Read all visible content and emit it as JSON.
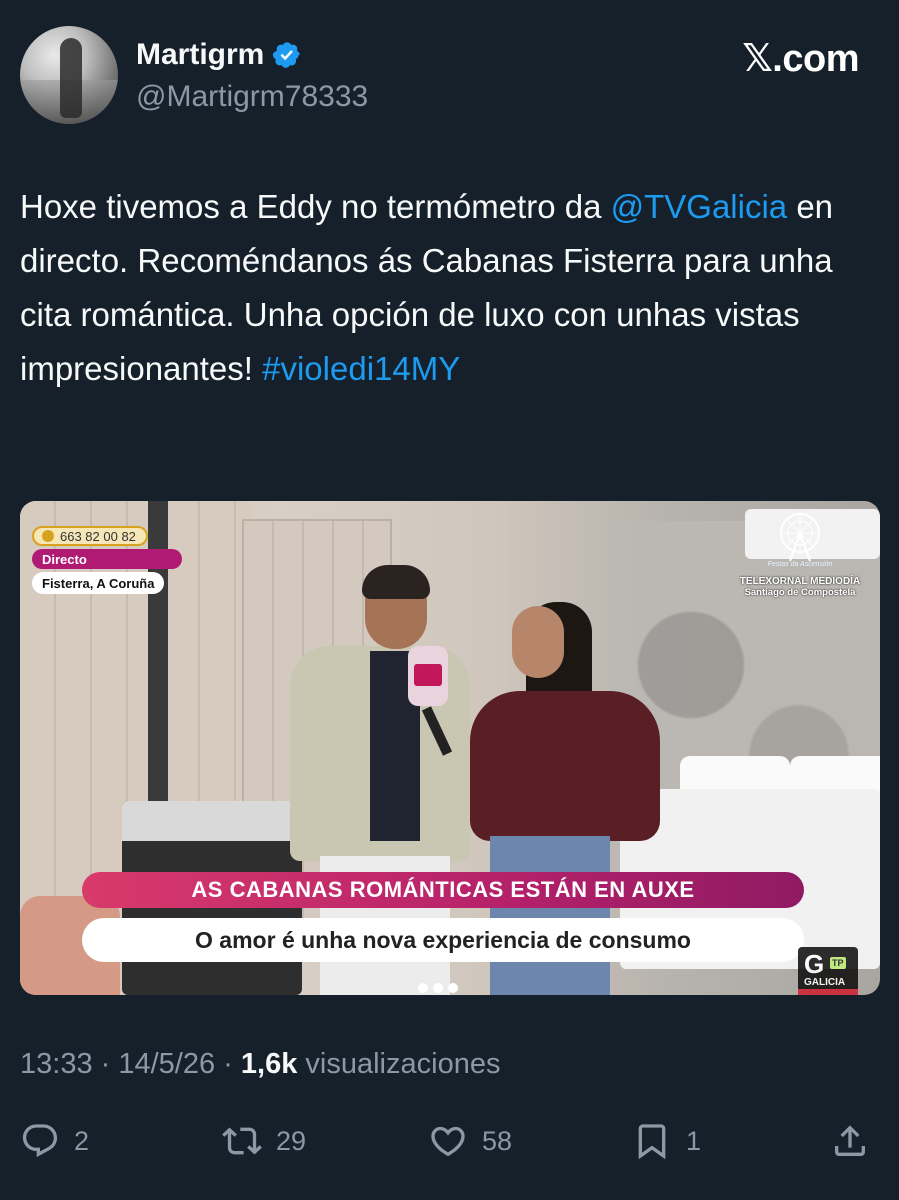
{
  "user": {
    "name": "Martigrm",
    "handle": "@Martigrm78333",
    "verified": true
  },
  "brand": {
    "logo_text": "𝕏.com"
  },
  "tweet": {
    "text_before_mention": "Hoxe tivemos a Eddy no termómetro da",
    "mention": "@TVGalicia",
    "text_after_mention": "  en directo. Recoméndanos ás Cabanas Fisterra para unha cita romántica. Unha opción de luxo con unhas vistas impresionantes!",
    "hashtag": "#violedi14MY"
  },
  "media": {
    "phone": "663 82 00 82",
    "live_label": "Directo",
    "location": "Fisterra, A Coruña",
    "festival_label": "Festas da Ascensión",
    "program": "TELEXORNAL MEDIODÍA",
    "program_city": "Santiago de Compostela",
    "headline": "AS CABANAS ROMÁNTICAS ESTÁN EN AUXE",
    "subheadline": "O amor é unha nova experiencia de consumo",
    "channel_g": "G",
    "channel_tp": "TP",
    "channel_name": "GALICIA"
  },
  "meta": {
    "time": "13:33",
    "separator": " · ",
    "date": "14/5/26",
    "views_count": "1,6k",
    "views_label": " visualizaciones"
  },
  "actions": {
    "replies": "2",
    "reposts": "29",
    "likes": "58",
    "bookmarks": "1"
  },
  "colors": {
    "background": "#15202b",
    "link": "#1d9bf0",
    "secondary_text": "#8b98a5",
    "verified": "#1d9bf0",
    "banner": "#b4206a"
  }
}
